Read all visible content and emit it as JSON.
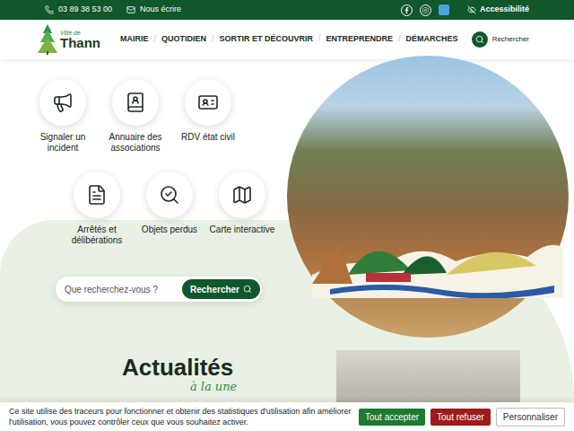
{
  "topbar": {
    "phone": "03 89 38 53 00",
    "email": "Nous écrire",
    "accessibility": "Accessibilité"
  },
  "logo": {
    "small": "Ville de",
    "name": "Thann"
  },
  "nav": {
    "items": [
      {
        "label": "MAIRIE"
      },
      {
        "label": "QUOTIDIEN"
      },
      {
        "label": "SORTIR ET DÉCOUVRIR"
      },
      {
        "label": "ENTREPRENDRE"
      },
      {
        "label": "DÉMARCHES"
      }
    ],
    "separator": "/",
    "search": "Rechercher"
  },
  "quick_links": [
    {
      "label": "Signaler un incident",
      "kind": "megaphone"
    },
    {
      "label": "Annuaire des associations",
      "kind": "book"
    },
    {
      "label": "RDV état civil",
      "kind": "card"
    },
    {
      "label": "Arrêtés et délibérations",
      "kind": "document"
    },
    {
      "label": "Objets perdus",
      "kind": "lost"
    },
    {
      "label": "Carte interactive",
      "kind": "map"
    }
  ],
  "search": {
    "placeholder": "Que recherchez-vous ?",
    "button": "Rechercher"
  },
  "news": {
    "title": "Actualités",
    "subtitle": "à la une"
  },
  "cookie": {
    "text": "Ce site utilise des traceurs pour fonctionner et obtenir des statistiques d'utilisation afin améliorer l'utilisation, vous pouvez contrôler ceux que vous souhaitez activer.",
    "buttons": [
      {
        "label": "Tout accepter",
        "kind": "accept"
      },
      {
        "label": "Tout refuser",
        "kind": "refuse"
      },
      {
        "label": "Personnaliser",
        "kind": "custom"
      }
    ]
  }
}
